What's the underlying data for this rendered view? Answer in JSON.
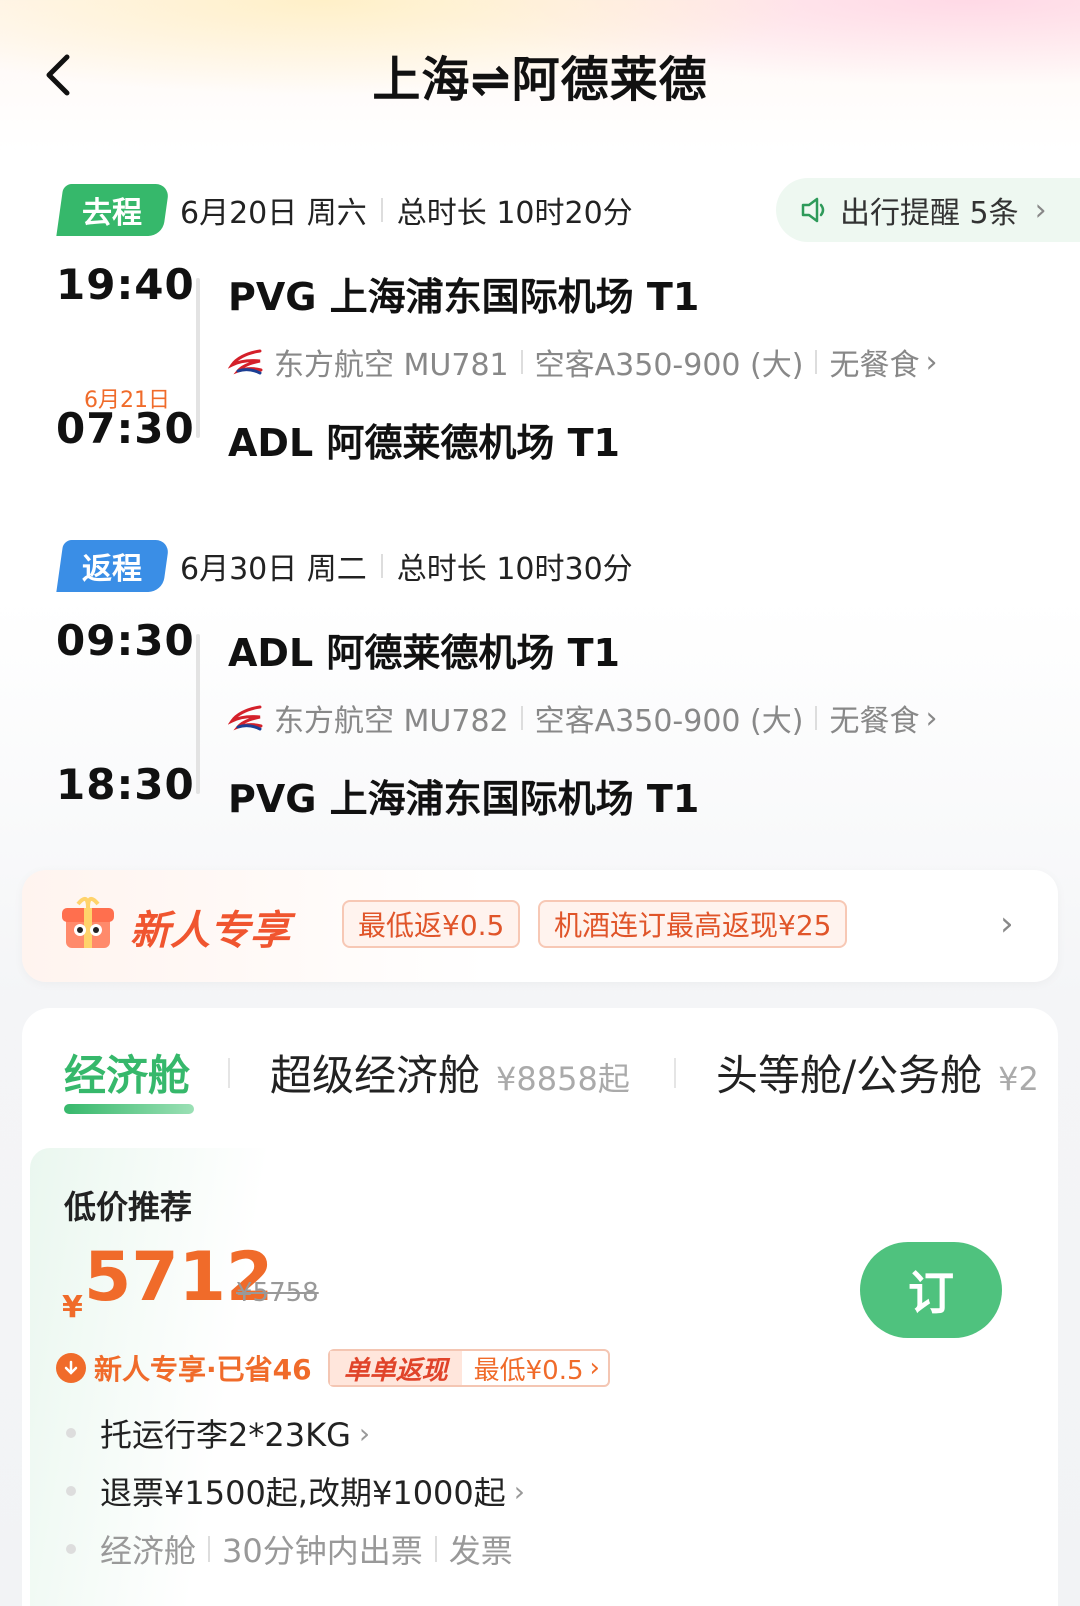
{
  "header": {
    "title": "上海⇌阿德莱德"
  },
  "outbound": {
    "tag": "去程",
    "date": "6月20日 周六",
    "duration": "总时长 10时20分",
    "reminder": {
      "label": "出行提醒 5条"
    },
    "depart_time": "19:40",
    "depart_airport": "PVG 上海浦东国际机场 T1",
    "airline": "东方航空 MU781",
    "aircraft": "空客A350-900 (大)",
    "meal": "无餐食",
    "arrive_nextday": "6月21日",
    "arrive_time": "07:30",
    "arrive_airport": "ADL 阿德莱德机场 T1"
  },
  "return": {
    "tag": "返程",
    "date": "6月30日 周二",
    "duration": "总时长 10时30分",
    "depart_time": "09:30",
    "depart_airport": "ADL 阿德莱德机场 T1",
    "airline": "东方航空 MU782",
    "aircraft": "空客A350-900 (大)",
    "meal": "无餐食",
    "arrive_time": "18:30",
    "arrive_airport": "PVG 上海浦东国际机场 T1"
  },
  "promo": {
    "title": "新人专享",
    "chip1": "最低返¥0.5",
    "chip2": "机酒连订最高返现¥25"
  },
  "cabin_tabs": [
    {
      "label": "经济舱",
      "price": ""
    },
    {
      "label": "超级经济舱",
      "price": "¥8858起"
    },
    {
      "label": "头等舱/公务舱",
      "price": "¥2"
    }
  ],
  "recommend": {
    "title": "低价推荐",
    "currency": "¥",
    "price": "5712",
    "old_price": "¥5758",
    "book_label": "订",
    "saving": "新人专享·已省46",
    "cashback_tag": "单单返现",
    "cashback_value": "最低¥0.5",
    "baggage": "托运行李2*23KG",
    "refund": "退票¥1500起,改期¥1000起",
    "cabin": "经济舱",
    "ticketing": "30分钟内出票",
    "invoice": "发票"
  },
  "colors": {
    "green": "#36b86b",
    "blue": "#3a8ee6",
    "orange": "#f06b2a"
  }
}
